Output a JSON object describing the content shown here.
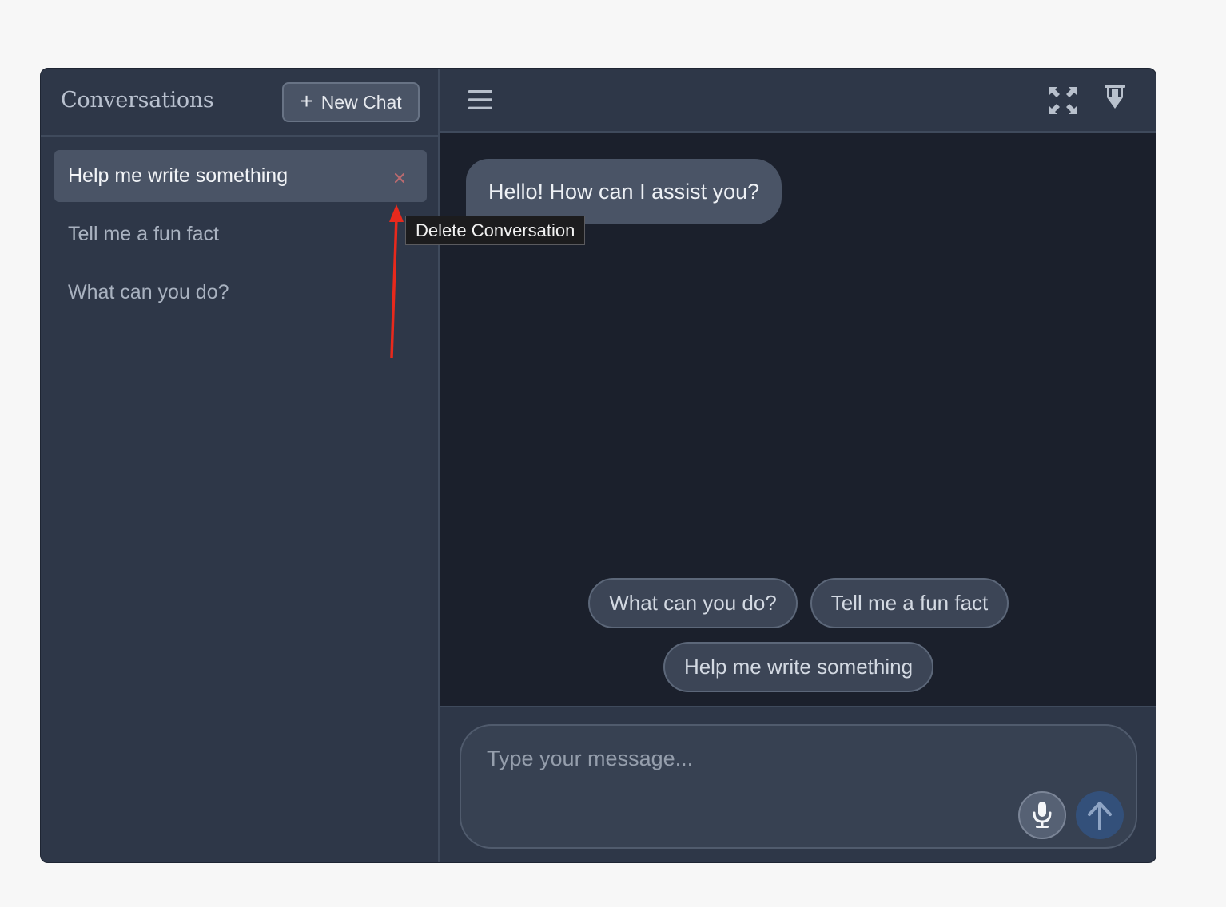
{
  "sidebar": {
    "title": "Conversations",
    "new_chat_label": "New Chat",
    "conversations": [
      {
        "label": "Help me write something",
        "active": true
      },
      {
        "label": "Tell me a fun fact",
        "active": false
      },
      {
        "label": "What can you do?",
        "active": false
      }
    ],
    "delete_icon": "close-icon"
  },
  "header": {
    "menu_icon": "hamburger-icon",
    "fullscreen_icon": "expand-icon",
    "download_icon": "download-icon"
  },
  "chat": {
    "messages": [
      {
        "role": "assistant",
        "text": "Hello! How can I assist you?"
      }
    ],
    "suggestions": [
      "What can you do?",
      "Tell me a fun fact",
      "Help me write something"
    ]
  },
  "composer": {
    "placeholder": "Type your message...",
    "value": "",
    "mic_icon": "microphone-icon",
    "send_icon": "arrow-up-icon"
  },
  "tooltip": {
    "text": "Delete Conversation"
  },
  "colors": {
    "sidebar_bg": "#2e3748",
    "chat_bg": "#1b202c",
    "active_item_bg": "#4a5466",
    "delete_icon": "#b96a6f",
    "send_button": "#33507a",
    "annotation_arrow": "#e8291c"
  }
}
